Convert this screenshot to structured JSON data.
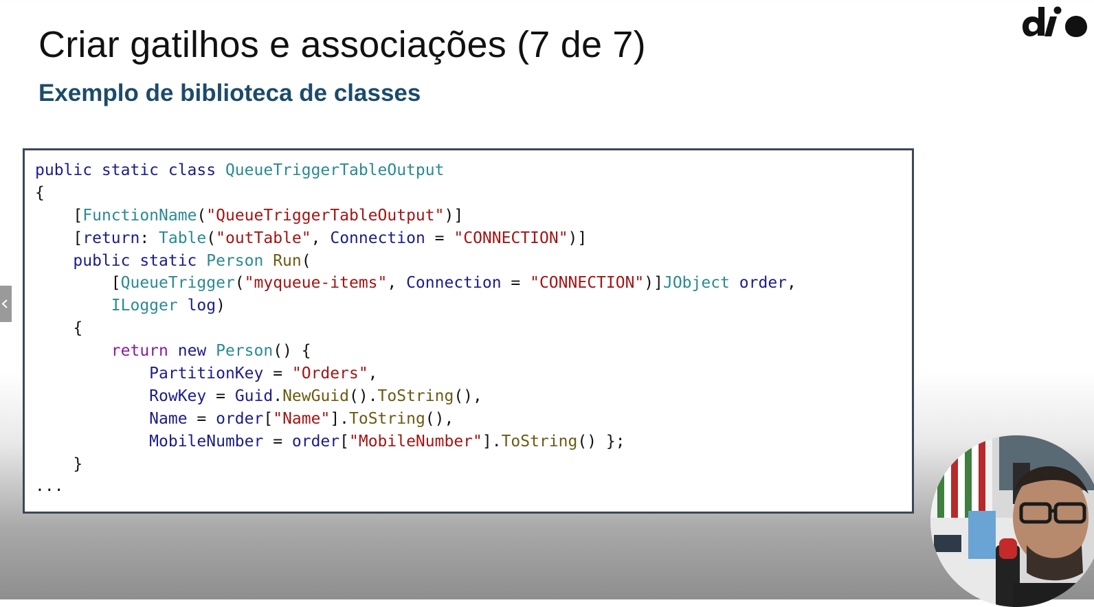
{
  "slide": {
    "title": "Criar gatilhos e associações (7 de 7)",
    "subtitle": "Exemplo de biblioteca de classes"
  },
  "code": {
    "language": "csharp",
    "lines": [
      [
        {
          "t": "public static class ",
          "c": "kw"
        },
        {
          "t": "QueueTriggerTableOutput",
          "c": "ty"
        }
      ],
      [
        {
          "t": "{",
          "c": ""
        }
      ],
      [
        {
          "t": "    [",
          "c": ""
        },
        {
          "t": "FunctionName",
          "c": "ty"
        },
        {
          "t": "(",
          "c": ""
        },
        {
          "t": "\"QueueTriggerTableOutput\"",
          "c": "st"
        },
        {
          "t": ")]",
          "c": ""
        }
      ],
      [
        {
          "t": "    [",
          "c": ""
        },
        {
          "t": "return",
          "c": "kw"
        },
        {
          "t": ": ",
          "c": ""
        },
        {
          "t": "Table",
          "c": "ty"
        },
        {
          "t": "(",
          "c": ""
        },
        {
          "t": "\"outTable\"",
          "c": "st"
        },
        {
          "t": ", ",
          "c": ""
        },
        {
          "t": "Connection",
          "c": "kw"
        },
        {
          "t": " = ",
          "c": ""
        },
        {
          "t": "\"CONNECTION\"",
          "c": "st"
        },
        {
          "t": ")]",
          "c": ""
        }
      ],
      [
        {
          "t": "    public static ",
          "c": "kw"
        },
        {
          "t": "Person",
          "c": "ty"
        },
        {
          "t": " ",
          "c": ""
        },
        {
          "t": "Run",
          "c": "fn"
        },
        {
          "t": "(",
          "c": ""
        }
      ],
      [
        {
          "t": "        [",
          "c": ""
        },
        {
          "t": "QueueTrigger",
          "c": "ty"
        },
        {
          "t": "(",
          "c": ""
        },
        {
          "t": "\"myqueue-items\"",
          "c": "st"
        },
        {
          "t": ", ",
          "c": ""
        },
        {
          "t": "Connection",
          "c": "kw"
        },
        {
          "t": " = ",
          "c": ""
        },
        {
          "t": "\"CONNECTION\"",
          "c": "st"
        },
        {
          "t": ")]",
          "c": ""
        },
        {
          "t": "JObject",
          "c": "ty"
        },
        {
          "t": " ",
          "c": ""
        },
        {
          "t": "order",
          "c": "kw"
        },
        {
          "t": ",",
          "c": ""
        }
      ],
      [
        {
          "t": "        ",
          "c": ""
        },
        {
          "t": "ILogger",
          "c": "ty"
        },
        {
          "t": " ",
          "c": ""
        },
        {
          "t": "log",
          "c": "kw"
        },
        {
          "t": ")",
          "c": ""
        }
      ],
      [
        {
          "t": "    {",
          "c": ""
        }
      ],
      [
        {
          "t": "        ",
          "c": ""
        },
        {
          "t": "return",
          "c": "ctl"
        },
        {
          "t": " ",
          "c": ""
        },
        {
          "t": "new",
          "c": "kw"
        },
        {
          "t": " ",
          "c": ""
        },
        {
          "t": "Person",
          "c": "ty"
        },
        {
          "t": "() {",
          "c": ""
        }
      ],
      [
        {
          "t": "            ",
          "c": ""
        },
        {
          "t": "PartitionKey",
          "c": "kw"
        },
        {
          "t": " = ",
          "c": ""
        },
        {
          "t": "\"Orders\"",
          "c": "st"
        },
        {
          "t": ",",
          "c": ""
        }
      ],
      [
        {
          "t": "            ",
          "c": ""
        },
        {
          "t": "RowKey",
          "c": "kw"
        },
        {
          "t": " = ",
          "c": ""
        },
        {
          "t": "Guid",
          "c": "kw"
        },
        {
          "t": ".",
          "c": ""
        },
        {
          "t": "NewGuid",
          "c": "fn"
        },
        {
          "t": "().",
          "c": ""
        },
        {
          "t": "ToString",
          "c": "fn"
        },
        {
          "t": "(),",
          "c": ""
        }
      ],
      [
        {
          "t": "            ",
          "c": ""
        },
        {
          "t": "Name",
          "c": "kw"
        },
        {
          "t": " = ",
          "c": ""
        },
        {
          "t": "order",
          "c": "kw"
        },
        {
          "t": "[",
          "c": ""
        },
        {
          "t": "\"Name\"",
          "c": "st"
        },
        {
          "t": "].",
          "c": ""
        },
        {
          "t": "ToString",
          "c": "fn"
        },
        {
          "t": "(),",
          "c": ""
        }
      ],
      [
        {
          "t": "            ",
          "c": ""
        },
        {
          "t": "MobileNumber",
          "c": "kw"
        },
        {
          "t": " = ",
          "c": ""
        },
        {
          "t": "order",
          "c": "kw"
        },
        {
          "t": "[",
          "c": ""
        },
        {
          "t": "\"MobileNumber\"",
          "c": "st"
        },
        {
          "t": "].",
          "c": ""
        },
        {
          "t": "ToString",
          "c": "fn"
        },
        {
          "t": "() };",
          "c": ""
        }
      ],
      [
        {
          "t": "    }",
          "c": ""
        }
      ],
      [
        {
          "t": "...",
          "c": ""
        }
      ]
    ]
  },
  "colors": {
    "keyword": "#1b1d8a",
    "type": "#2a8a91",
    "string": "#a31515",
    "method": "#6b5a12",
    "control": "#8b1aa3",
    "subtitle": "#1c4b6a"
  },
  "icons": {
    "brand_logo": "dio-logo-icon",
    "side_tab": "chevron-left-icon"
  }
}
